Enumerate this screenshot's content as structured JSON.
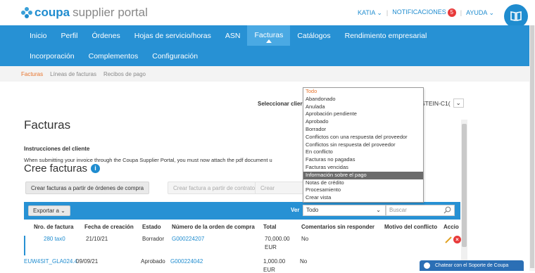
{
  "header": {
    "brand": "coupa",
    "brand_rest": "supplier portal",
    "user": "KATIA",
    "notifications_label": "NOTIFICACIONES",
    "notifications_count": "5",
    "help_label": "AYUDA"
  },
  "nav": {
    "row1": [
      "Inicio",
      "Perfil",
      "Órdenes",
      "Hojas de servicio/horas",
      "ASN",
      "Facturas",
      "Catálogos",
      "Rendimiento empresarial"
    ],
    "row2": [
      "Incorporación",
      "Complementos",
      "Configuración"
    ],
    "active": "Facturas"
  },
  "subtabs": [
    "Facturas",
    "Líneas de facturas",
    "Recibos de pago"
  ],
  "main": {
    "title": "Facturas",
    "select_client_label": "Seleccionar clier",
    "client_value": "STEIN-C1(",
    "instructions_title": "Instrucciones del cliente",
    "instructions_text": "When submitting your invoice through the Coupa Supplier Portal, you must now attach the pdf document u",
    "create_title": "Cree facturas",
    "btn_from_po": "Crear facturas a partir de órdenes de compra",
    "btn_from_contract": "Crear factura a partir de contrato",
    "btn_blank": "Crear"
  },
  "table": {
    "export_label": "Exportar a",
    "ver_label": "Ver",
    "filter_value": "Todo",
    "search_placeholder": "Buscar",
    "columns": [
      "Nro. de factura",
      "Fecha de creación",
      "Estado",
      "Número de la orden de compra",
      "Total",
      "Comentarios sin responder",
      "Motivo del conflicto",
      "Accio"
    ],
    "rows": [
      {
        "invoice": "280 tax0",
        "date": "21/10/21",
        "status": "Borrador",
        "po": "G000224207",
        "total": "70,000.00",
        "currency": "EUR",
        "comments": "No"
      },
      {
        "invoice": "EUW4SIT_GLA024.4",
        "date": "09/09/21",
        "status": "Aprobado",
        "po": "G000224042",
        "total": "1,000.00",
        "currency": "EUR",
        "comments": "No"
      }
    ]
  },
  "dropdown": {
    "options": [
      "Todo",
      "Abandonado",
      "Anulada",
      "Aprobación pendiente",
      "Aprobado",
      "Borrador",
      "Conflictos con una respuesta del proveedor",
      "Conflictos sin respuesta del proveedor",
      "En conflicto",
      "Facturas no pagadas",
      "Facturas vencidas",
      "Información sobre el pago",
      "Notas de crédito",
      "Procesamiento",
      "Crear vista"
    ],
    "current": "Todo",
    "highlighted": "Información sobre el pago"
  },
  "chat": {
    "label": "Chatear con el Soporte de Coupa"
  },
  "colors": {
    "nav_blue": "#2791d4",
    "accent_orange": "#e8752e",
    "link_blue": "#1f8ccf",
    "alert_red": "#e83a3a"
  },
  "icons": [
    "coupa-logo-icon",
    "book-icon",
    "info-icon",
    "chevron-down-icon",
    "search-icon",
    "pencil-icon",
    "delete-icon",
    "chat-icon"
  ]
}
